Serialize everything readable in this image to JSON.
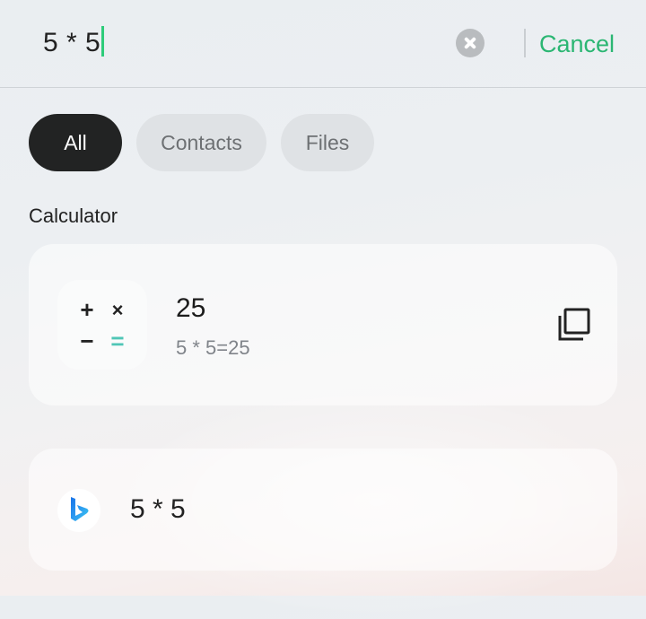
{
  "search": {
    "query": "5 * 5",
    "cancel_label": "Cancel"
  },
  "filters": [
    {
      "label": "All",
      "active": true
    },
    {
      "label": "Contacts",
      "active": false
    },
    {
      "label": "Files",
      "active": false
    }
  ],
  "section": {
    "title": "Calculator"
  },
  "calculator": {
    "icon": "calculator-icon",
    "symbols": {
      "plus": "+",
      "times": "×",
      "minus": "−",
      "equals": "="
    },
    "result": "25",
    "expression": "5 * 5=25",
    "copy_icon": "copy-icon"
  },
  "web_suggestion": {
    "icon": "bing-icon",
    "text": "5 * 5"
  },
  "colors": {
    "accent": "#2bb673",
    "chip_active": "#222323",
    "chip_inactive": "#dfe2e5",
    "equals": "#4fc6b6"
  }
}
